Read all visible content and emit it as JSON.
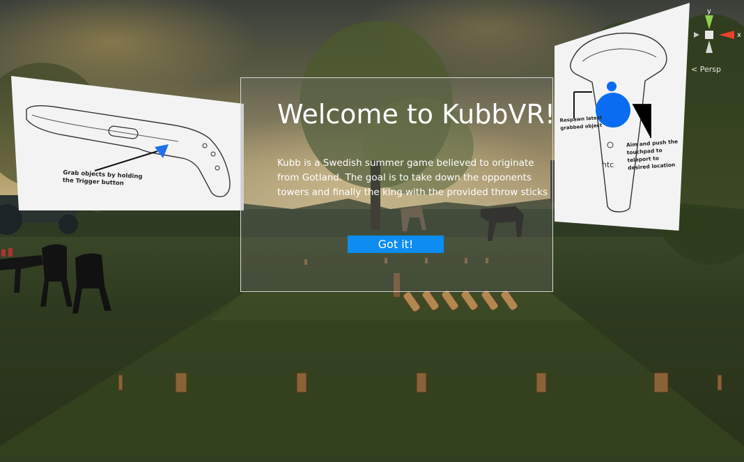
{
  "dialog": {
    "title": "Welcome to KubbVR!",
    "body": "Kubb is a Swedish summer game believed to originate from Gotland. The goal is to take down the opponents towers and finally the king with the provided throw sticks",
    "button_label": "Got it!"
  },
  "left_card": {
    "caption_line1": "Grab objects by holding",
    "caption_line2": "the Trigger button"
  },
  "right_card": {
    "respawn_line1": "Respawn latest",
    "respawn_line2": "grabbed object",
    "aim_line1": "Aim and push the",
    "aim_line2": "touchpad to",
    "aim_line3": "teleport to",
    "aim_line4": "desired location",
    "brand": "htc"
  },
  "gizmo": {
    "y_label": "y",
    "x_label": "x",
    "view_label": "< Persp"
  },
  "colors": {
    "button": "#0d8cf2",
    "accent_blue": "#0a6cf0",
    "gizmo_y": "#8fd14f",
    "gizmo_x": "#e8402c"
  }
}
